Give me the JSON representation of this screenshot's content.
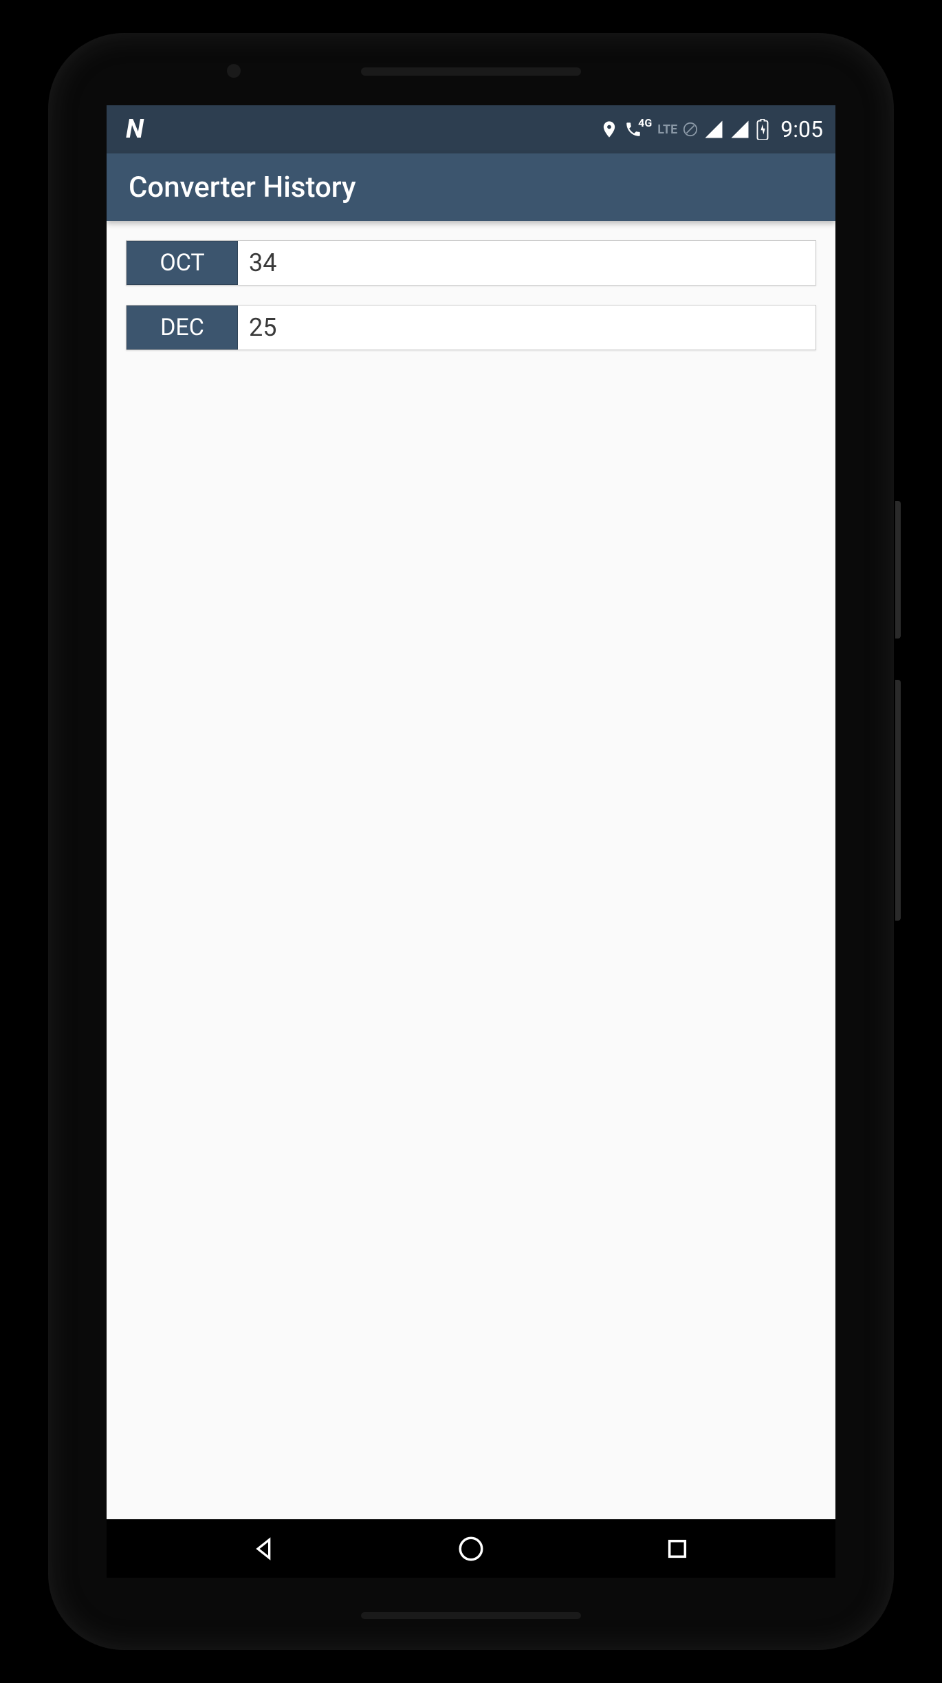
{
  "status": {
    "time": "9:05",
    "lte_text": "LTE",
    "4g_text": "4G"
  },
  "appbar": {
    "title": "Converter History"
  },
  "history": [
    {
      "base": "OCT",
      "value": "34"
    },
    {
      "base": "DEC",
      "value": "25"
    }
  ]
}
